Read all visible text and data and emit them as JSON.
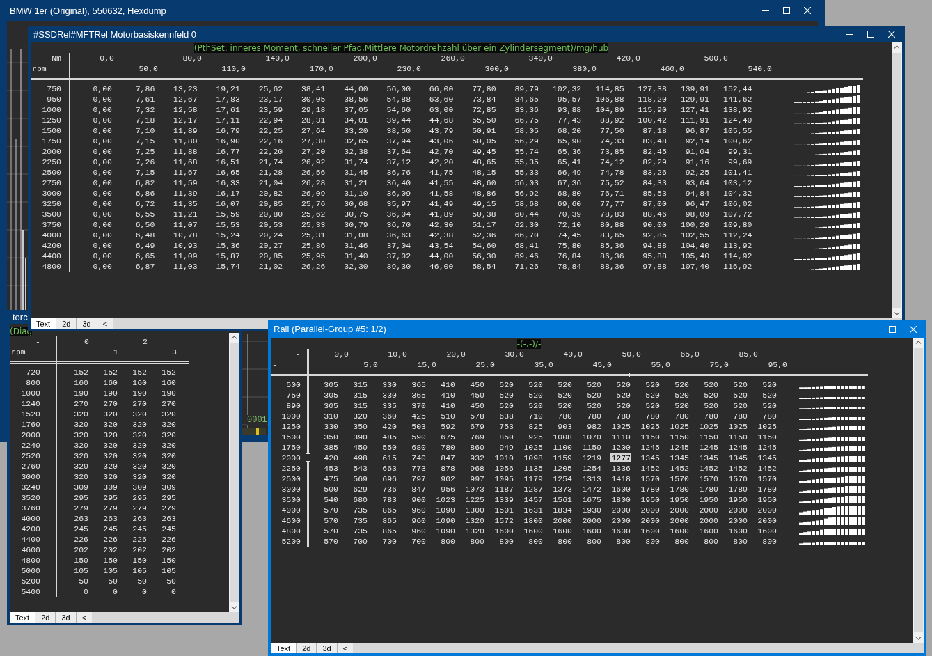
{
  "hexdump_window": {
    "title": "BMW 1er (Original), 550632, Hexdump",
    "active": false,
    "counter_text": "0001"
  },
  "side_window": {
    "title": "torc",
    "active": false,
    "caption": "(Diag",
    "tabs": [
      {
        "label": "Text",
        "selected": true
      },
      {
        "label": "2d",
        "selected": false
      },
      {
        "label": "3d",
        "selected": false
      }
    ],
    "scroll_left": "<",
    "table": {
      "corner_top": "-",
      "corner_bottom": "rpm",
      "columns": [
        "0",
        "1",
        "2",
        "3"
      ],
      "rows": [
        {
          "label": "720",
          "values": [
            "152",
            "152",
            "152",
            "152"
          ]
        },
        {
          "label": "800",
          "values": [
            "160",
            "160",
            "160",
            "160"
          ]
        },
        {
          "label": "1000",
          "values": [
            "190",
            "190",
            "190",
            "190"
          ]
        },
        {
          "label": "1240",
          "values": [
            "270",
            "270",
            "270",
            "270"
          ]
        },
        {
          "label": "1520",
          "values": [
            "320",
            "320",
            "320",
            "320"
          ]
        },
        {
          "label": "1760",
          "values": [
            "320",
            "320",
            "320",
            "320"
          ]
        },
        {
          "label": "2000",
          "values": [
            "320",
            "320",
            "320",
            "320"
          ]
        },
        {
          "label": "2240",
          "values": [
            "320",
            "320",
            "320",
            "320"
          ]
        },
        {
          "label": "2520",
          "values": [
            "320",
            "320",
            "320",
            "320"
          ]
        },
        {
          "label": "2760",
          "values": [
            "320",
            "320",
            "320",
            "320"
          ]
        },
        {
          "label": "3000",
          "values": [
            "320",
            "320",
            "320",
            "320"
          ]
        },
        {
          "label": "3240",
          "values": [
            "309",
            "309",
            "309",
            "309"
          ]
        },
        {
          "label": "3520",
          "values": [
            "295",
            "295",
            "295",
            "295"
          ]
        },
        {
          "label": "3760",
          "values": [
            "279",
            "279",
            "279",
            "279"
          ]
        },
        {
          "label": "4000",
          "values": [
            "263",
            "263",
            "263",
            "263"
          ]
        },
        {
          "label": "4200",
          "values": [
            "245",
            "245",
            "245",
            "245"
          ]
        },
        {
          "label": "4400",
          "values": [
            "226",
            "226",
            "226",
            "226"
          ]
        },
        {
          "label": "4600",
          "values": [
            "202",
            "202",
            "202",
            "202"
          ]
        },
        {
          "label": "4800",
          "values": [
            "150",
            "150",
            "150",
            "150"
          ]
        },
        {
          "label": "5000",
          "values": [
            "105",
            "105",
            "105",
            "105"
          ]
        },
        {
          "label": "5200",
          "values": [
            "50",
            "50",
            "50",
            "50"
          ]
        },
        {
          "label": "5400",
          "values": [
            "0",
            "0",
            "0",
            "0"
          ]
        }
      ]
    }
  },
  "map_window": {
    "title": "#SSDRel#MFTRel Motorbasiskennfeld 0",
    "active": false,
    "caption": "(PthSet: inneres Moment, schneller Pfad,Mittlere Motordrehzahl über ein Zylindersegment)/mg/hub",
    "tabs": [
      {
        "label": "Text",
        "selected": true
      },
      {
        "label": "2d",
        "selected": false
      },
      {
        "label": "3d",
        "selected": false
      }
    ],
    "scroll_left": "<",
    "table": {
      "corner_top": "Nm",
      "corner_bottom": "rpm",
      "columns": [
        "0,0",
        "50,0",
        "80,0",
        "110,0",
        "140,0",
        "170,0",
        "200,0",
        "230,0",
        "260,0",
        "300,0",
        "340,0",
        "380,0",
        "420,0",
        "460,0",
        "500,0",
        "540,0"
      ],
      "rows": [
        {
          "label": "750",
          "values": [
            "0,00",
            "7,86",
            "13,23",
            "19,21",
            "25,62",
            "38,41",
            "44,00",
            "56,00",
            "66,00",
            "77,80",
            "89,79",
            "102,32",
            "114,85",
            "127,38",
            "139,91",
            "152,44"
          ]
        },
        {
          "label": "950",
          "values": [
            "0,00",
            "7,61",
            "12,67",
            "17,83",
            "23,17",
            "30,05",
            "38,56",
            "54,88",
            "63,60",
            "73,84",
            "84,65",
            "95,57",
            "106,88",
            "118,20",
            "129,91",
            "141,62"
          ]
        },
        {
          "label": "1000",
          "values": [
            "0,00",
            "7,32",
            "12,58",
            "17,61",
            "23,59",
            "29,18",
            "37,05",
            "54,60",
            "63,00",
            "72,85",
            "83,36",
            "93,88",
            "104,89",
            "115,90",
            "127,41",
            "138,92"
          ]
        },
        {
          "label": "1250",
          "values": [
            "0,00",
            "7,18",
            "12,17",
            "17,11",
            "22,94",
            "28,31",
            "34,01",
            "39,44",
            "44,68",
            "55,50",
            "66,75",
            "77,43",
            "88,92",
            "100,42",
            "111,91",
            "124,40"
          ]
        },
        {
          "label": "1500",
          "values": [
            "0,00",
            "7,10",
            "11,89",
            "16,79",
            "22,25",
            "27,64",
            "33,20",
            "38,50",
            "43,79",
            "50,91",
            "58,05",
            "68,20",
            "77,50",
            "87,18",
            "96,87",
            "105,55"
          ]
        },
        {
          "label": "1750",
          "values": [
            "0,00",
            "7,15",
            "11,80",
            "16,90",
            "22,16",
            "27,30",
            "32,65",
            "37,94",
            "43,06",
            "50,05",
            "56,29",
            "65,90",
            "74,33",
            "83,48",
            "92,14",
            "100,62"
          ]
        },
        {
          "label": "2000",
          "values": [
            "0,00",
            "7,25",
            "11,88",
            "16,77",
            "22,20",
            "27,20",
            "32,38",
            "37,64",
            "42,70",
            "49,45",
            "55,74",
            "65,36",
            "73,85",
            "82,45",
            "91,04",
            "99,31"
          ]
        },
        {
          "label": "2250",
          "values": [
            "0,00",
            "7,26",
            "11,68",
            "16,51",
            "21,74",
            "26,92",
            "31,74",
            "37,12",
            "42,20",
            "48,65",
            "55,35",
            "65,41",
            "74,12",
            "82,29",
            "91,16",
            "99,69"
          ]
        },
        {
          "label": "2500",
          "values": [
            "0,00",
            "7,15",
            "11,67",
            "16,65",
            "21,28",
            "26,56",
            "31,45",
            "36,76",
            "41,75",
            "48,15",
            "55,33",
            "66,49",
            "74,78",
            "83,26",
            "92,25",
            "101,41"
          ]
        },
        {
          "label": "2750",
          "values": [
            "0,00",
            "6,82",
            "11,59",
            "16,33",
            "21,04",
            "26,28",
            "31,21",
            "36,40",
            "41,55",
            "48,60",
            "56,03",
            "67,36",
            "75,52",
            "84,33",
            "93,64",
            "103,12"
          ]
        },
        {
          "label": "3000",
          "values": [
            "0,00",
            "6,86",
            "11,39",
            "16,17",
            "20,82",
            "26,09",
            "31,10",
            "36,09",
            "41,58",
            "48,86",
            "56,92",
            "68,80",
            "76,71",
            "85,53",
            "94,84",
            "104,32"
          ]
        },
        {
          "label": "3250",
          "values": [
            "0,00",
            "6,72",
            "11,35",
            "16,07",
            "20,85",
            "25,76",
            "30,68",
            "35,97",
            "41,49",
            "49,15",
            "58,68",
            "69,60",
            "77,77",
            "87,00",
            "96,47",
            "106,02"
          ]
        },
        {
          "label": "3500",
          "values": [
            "0,00",
            "6,55",
            "11,21",
            "15,59",
            "20,80",
            "25,62",
            "30,75",
            "36,04",
            "41,89",
            "50,38",
            "60,44",
            "70,39",
            "78,83",
            "88,46",
            "98,09",
            "107,72"
          ]
        },
        {
          "label": "3750",
          "values": [
            "0,00",
            "6,50",
            "11,07",
            "15,53",
            "20,53",
            "25,33",
            "30,79",
            "36,70",
            "42,30",
            "51,17",
            "62,30",
            "72,10",
            "80,88",
            "90,00",
            "100,20",
            "109,80"
          ]
        },
        {
          "label": "4000",
          "values": [
            "0,00",
            "6,48",
            "10,78",
            "15,24",
            "20,24",
            "25,31",
            "31,08",
            "36,63",
            "42,38",
            "52,36",
            "66,70",
            "74,45",
            "83,65",
            "92,85",
            "102,55",
            "112,24"
          ]
        },
        {
          "label": "4200",
          "values": [
            "0,00",
            "6,49",
            "10,93",
            "15,36",
            "20,27",
            "25,86",
            "31,46",
            "37,04",
            "43,54",
            "54,60",
            "68,41",
            "75,80",
            "85,36",
            "94,88",
            "104,40",
            "113,92"
          ]
        },
        {
          "label": "4400",
          "values": [
            "0,00",
            "6,65",
            "11,09",
            "15,87",
            "20,85",
            "25,95",
            "31,40",
            "37,02",
            "44,00",
            "56,30",
            "69,46",
            "76,84",
            "86,36",
            "95,88",
            "105,40",
            "114,92"
          ]
        },
        {
          "label": "4800",
          "values": [
            "0,00",
            "6,87",
            "11,03",
            "15,74",
            "21,02",
            "26,26",
            "32,30",
            "39,30",
            "46,00",
            "58,54",
            "71,26",
            "78,84",
            "88,36",
            "97,88",
            "107,40",
            "116,92"
          ]
        }
      ]
    }
  },
  "rail_window": {
    "title": "Rail (Parallel-Group #5: 1/2)",
    "active": true,
    "caption": "-(-,-)/-",
    "tabs": [
      {
        "label": "Text",
        "selected": true
      },
      {
        "label": "2d",
        "selected": false
      },
      {
        "label": "3d",
        "selected": false
      }
    ],
    "scroll_left": "<",
    "table": {
      "corner_top": "-",
      "corner_bottom": "-",
      "columns": [
        {
          "label": "0,0",
          "selected": false
        },
        {
          "label": "5,0",
          "selected": false
        },
        {
          "label": "10,0",
          "selected": false
        },
        {
          "label": "15,0",
          "selected": false
        },
        {
          "label": "20,0",
          "selected": false
        },
        {
          "label": "25,0",
          "selected": false
        },
        {
          "label": "30,0",
          "selected": false
        },
        {
          "label": "35,0",
          "selected": false
        },
        {
          "label": "40,0",
          "selected": false
        },
        {
          "label": "45,0",
          "selected": false
        },
        {
          "label": "50,0",
          "selected": true
        },
        {
          "label": "55,0",
          "selected": false
        },
        {
          "label": "65,0",
          "selected": false
        },
        {
          "label": "75,0",
          "selected": false
        },
        {
          "label": "85,0",
          "selected": false
        },
        {
          "label": "95,0",
          "selected": false
        }
      ],
      "rows": [
        {
          "label": "500",
          "selected": false,
          "values": [
            "305",
            "315",
            "330",
            "365",
            "410",
            "450",
            "520",
            "520",
            "520",
            "520",
            "520",
            "520",
            "520",
            "520",
            "520",
            "520"
          ]
        },
        {
          "label": "750",
          "selected": false,
          "values": [
            "305",
            "315",
            "330",
            "365",
            "410",
            "450",
            "520",
            "520",
            "520",
            "520",
            "520",
            "520",
            "520",
            "520",
            "520",
            "520"
          ]
        },
        {
          "label": "890",
          "selected": false,
          "values": [
            "305",
            "315",
            "335",
            "370",
            "410",
            "450",
            "520",
            "520",
            "520",
            "520",
            "520",
            "520",
            "520",
            "520",
            "520",
            "520"
          ]
        },
        {
          "label": "1000",
          "selected": false,
          "values": [
            "310",
            "320",
            "360",
            "425",
            "510",
            "578",
            "638",
            "710",
            "780",
            "780",
            "780",
            "780",
            "780",
            "780",
            "780",
            "780"
          ]
        },
        {
          "label": "1250",
          "selected": false,
          "values": [
            "330",
            "350",
            "420",
            "503",
            "592",
            "679",
            "753",
            "825",
            "903",
            "982",
            "1025",
            "1025",
            "1025",
            "1025",
            "1025",
            "1025"
          ]
        },
        {
          "label": "1500",
          "selected": false,
          "values": [
            "350",
            "390",
            "485",
            "590",
            "675",
            "769",
            "850",
            "925",
            "1008",
            "1070",
            "1110",
            "1150",
            "1150",
            "1150",
            "1150",
            "1150"
          ]
        },
        {
          "label": "1750",
          "selected": false,
          "values": [
            "385",
            "450",
            "550",
            "680",
            "780",
            "860",
            "949",
            "1025",
            "1100",
            "1150",
            "1200",
            "1245",
            "1245",
            "1245",
            "1245",
            "1245"
          ]
        },
        {
          "label": "2000",
          "selected": true,
          "values": [
            "420",
            "498",
            "615",
            "740",
            "847",
            "932",
            "1010",
            "1098",
            "1159",
            "1219",
            "1277",
            "1345",
            "1345",
            "1345",
            "1345",
            "1345"
          ]
        },
        {
          "label": "2250",
          "selected": false,
          "values": [
            "453",
            "543",
            "663",
            "773",
            "878",
            "968",
            "1056",
            "1135",
            "1205",
            "1254",
            "1336",
            "1452",
            "1452",
            "1452",
            "1452",
            "1452"
          ]
        },
        {
          "label": "2500",
          "selected": false,
          "values": [
            "475",
            "569",
            "696",
            "797",
            "902",
            "997",
            "1095",
            "1179",
            "1254",
            "1313",
            "1418",
            "1570",
            "1570",
            "1570",
            "1570",
            "1570"
          ]
        },
        {
          "label": "3000",
          "selected": false,
          "values": [
            "500",
            "629",
            "736",
            "847",
            "956",
            "1073",
            "1187",
            "1287",
            "1373",
            "1472",
            "1600",
            "1780",
            "1780",
            "1780",
            "1780",
            "1780"
          ]
        },
        {
          "label": "3500",
          "selected": false,
          "values": [
            "540",
            "680",
            "783",
            "900",
            "1023",
            "1225",
            "1339",
            "1457",
            "1561",
            "1675",
            "1800",
            "1950",
            "1950",
            "1950",
            "1950",
            "1950"
          ]
        },
        {
          "label": "4000",
          "selected": false,
          "values": [
            "570",
            "735",
            "865",
            "960",
            "1090",
            "1300",
            "1501",
            "1631",
            "1834",
            "1930",
            "2000",
            "2000",
            "2000",
            "2000",
            "2000",
            "2000"
          ]
        },
        {
          "label": "4600",
          "selected": false,
          "values": [
            "570",
            "735",
            "865",
            "960",
            "1090",
            "1320",
            "1572",
            "1800",
            "2000",
            "2000",
            "2000",
            "2000",
            "2000",
            "2000",
            "2000",
            "2000"
          ]
        },
        {
          "label": "4800",
          "selected": false,
          "values": [
            "570",
            "735",
            "865",
            "960",
            "1090",
            "1320",
            "1600",
            "1600",
            "1600",
            "1600",
            "1600",
            "1600",
            "1600",
            "1600",
            "1600",
            "1600"
          ]
        },
        {
          "label": "5200",
          "selected": false,
          "values": [
            "570",
            "700",
            "700",
            "700",
            "800",
            "800",
            "800",
            "800",
            "800",
            "800",
            "800",
            "800",
            "800",
            "800",
            "800",
            "800"
          ]
        }
      ]
    }
  }
}
